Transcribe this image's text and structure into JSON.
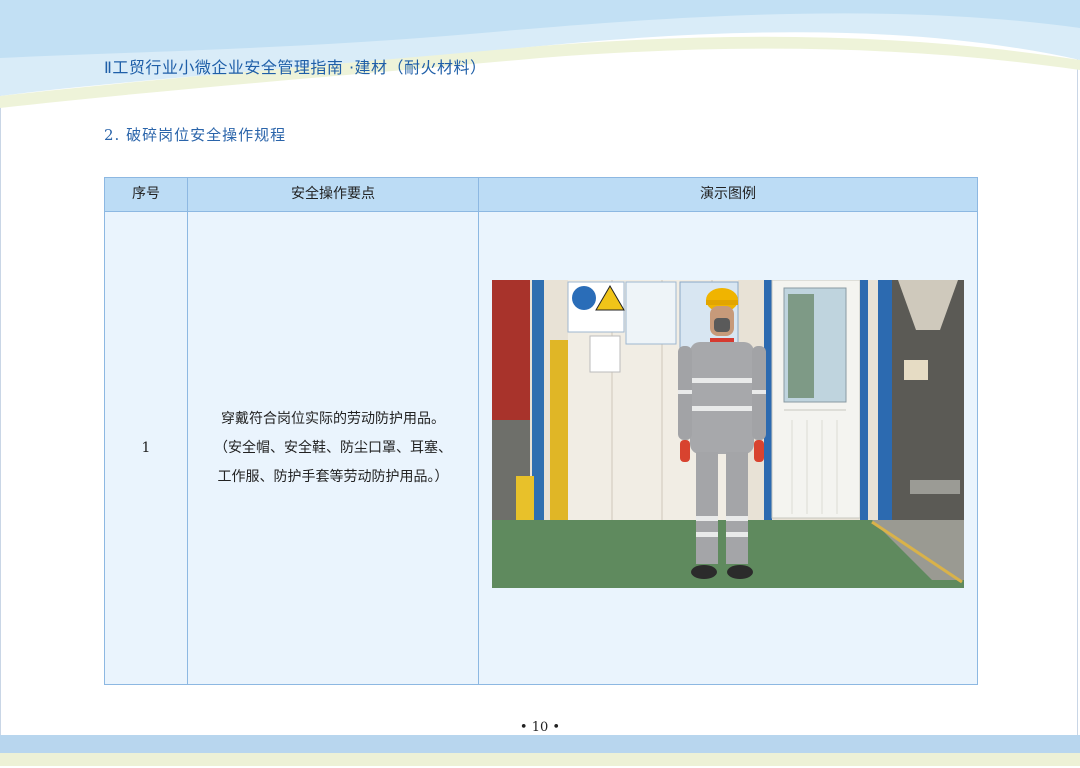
{
  "header": {
    "title": "Ⅱ工贸行业小微企业安全管理指南 ·建材（耐火材料）"
  },
  "section": {
    "title": "2. 破碎岗位安全操作规程"
  },
  "table": {
    "headers": [
      "序号",
      "安全操作要点",
      "演示图例"
    ],
    "rows": [
      {
        "num": "1",
        "lines": [
          "穿戴符合岗位实际的劳动防护用品。",
          "（安全帽、安全鞋、防尘口罩、耳塞、",
          "工作服、防护手套等劳动防护用品。）"
        ]
      }
    ]
  },
  "footer": {
    "page": "• 10 •"
  },
  "colors": {
    "header_bg": "#bcdcf5",
    "body_bg": "#eaf4fd",
    "border": "#8db8e2",
    "title_blue": "#1f5fa8"
  }
}
